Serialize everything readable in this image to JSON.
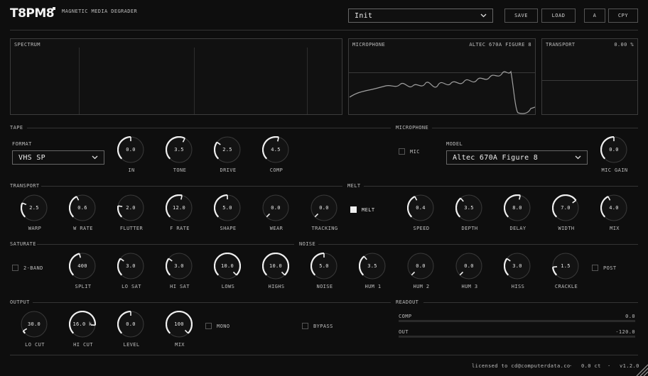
{
  "header": {
    "logo": "T8PM8",
    "subtitle": "MAGNETIC MEDIA DEGRADER",
    "preset": "Init",
    "buttons": [
      "SAVE",
      "LOAD",
      "A",
      "CPY"
    ]
  },
  "displays": {
    "spectrum": {
      "title": "SPECTRUM"
    },
    "microphone": {
      "title": "MICROPHONE",
      "model": "ALTEC 670A FIGURE 8"
    },
    "transport": {
      "title": "TRANSPORT",
      "value": "0.00 %"
    }
  },
  "tape": {
    "title": "TAPE",
    "format_label": "FORMAT",
    "format": "VHS SP",
    "knobs": [
      {
        "label": "IN",
        "value": "0.0",
        "level": 0.5
      },
      {
        "label": "TONE",
        "value": "3.5",
        "level": 0.6
      },
      {
        "label": "DRIVE",
        "value": "2.5",
        "level": 0.3
      },
      {
        "label": "COMP",
        "value": "4.5",
        "level": 0.55
      }
    ]
  },
  "microphone": {
    "title": "MICROPHONE",
    "mic_label": "MIC",
    "model_label": "MODEL",
    "model": "Altec 670A Figure 8",
    "gain": {
      "label": "MIC GAIN",
      "value": "0.0",
      "level": 0.5
    }
  },
  "transport": {
    "title": "TRANSPORT",
    "knobs": [
      {
        "label": "WARP",
        "value": "2.5",
        "level": 0.25
      },
      {
        "label": "W RATE",
        "value": "0.6",
        "level": 0.4
      },
      {
        "label": "FLUTTER",
        "value": "2.0",
        "level": 0.2
      },
      {
        "label": "F RATE",
        "value": "12.0",
        "level": 0.55
      },
      {
        "label": "SHAPE",
        "value": "5.0",
        "level": 0.5
      },
      {
        "label": "WEAR",
        "value": "0.0",
        "level": 0.0
      },
      {
        "label": "TRACKING",
        "value": "0.0",
        "level": 0.0
      }
    ]
  },
  "melt": {
    "title": "MELT",
    "toggle_label": "MELT",
    "knobs": [
      {
        "label": "SPEED",
        "value": "0.4",
        "level": 0.4
      },
      {
        "label": "DEPTH",
        "value": "3.5",
        "level": 0.35
      },
      {
        "label": "DELAY",
        "value": "8.0",
        "level": 0.55
      },
      {
        "label": "WIDTH",
        "value": "7.0",
        "level": 0.7
      },
      {
        "label": "MIX",
        "value": "4.0",
        "level": 0.4
      }
    ]
  },
  "saturate": {
    "title": "SATURATE",
    "twoband_label": "2-BAND",
    "knobs": [
      {
        "label": "SPLIT",
        "value": "400",
        "level": 0.45
      },
      {
        "label": "LO SAT",
        "value": "3.0",
        "level": 0.3
      },
      {
        "label": "HI SAT",
        "value": "3.0",
        "level": 0.3
      }
    ]
  },
  "noise": {
    "title": "NOISE",
    "post_label": "POST",
    "knobs": [
      {
        "label": "LOWS",
        "value": "10.0",
        "level": 1.0
      },
      {
        "label": "HIGHS",
        "value": "10.0",
        "level": 1.0
      },
      {
        "label": "NOISE",
        "value": "5.0",
        "level": 0.5
      },
      {
        "label": "HUM 1",
        "value": "3.5",
        "level": 0.35
      },
      {
        "label": "HUM 2",
        "value": "0.0",
        "level": 0.0
      },
      {
        "label": "HUM 3",
        "value": "0.0",
        "level": 0.0
      },
      {
        "label": "HISS",
        "value": "3.0",
        "level": 0.3
      },
      {
        "label": "CRACKLE",
        "value": "1.5",
        "level": 0.15
      }
    ]
  },
  "output": {
    "title": "OUTPUT",
    "mono_label": "MONO",
    "bypass_label": "BYPASS",
    "knobs": [
      {
        "label": "LO CUT",
        "value": "30.0",
        "level": 0.05
      },
      {
        "label": "HI CUT",
        "value": "16.0 k",
        "level": 0.85
      },
      {
        "label": "LEVEL",
        "value": "0.0",
        "level": 0.5
      },
      {
        "label": "MIX",
        "value": "100",
        "level": 1.0
      }
    ]
  },
  "readout": {
    "title": "READOUT",
    "comp_label": "COMP",
    "comp_value": "0.0",
    "out_label": "OUT",
    "out_value": "-120.0"
  },
  "footer": {
    "license": "licensed to cd@computerdata.co",
    "sep1": "·",
    "tuning": "0.0 ct",
    "sep2": "·",
    "version": "v1.2.0"
  },
  "colors": {
    "background": "#0e0e0e",
    "accent": "#f0f0f0",
    "panel_border": "#3c3c3c"
  }
}
